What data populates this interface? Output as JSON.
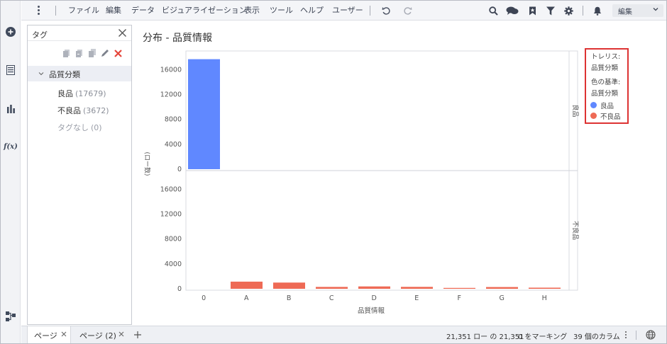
{
  "menubar": {
    "items": [
      "ファイル",
      "編集",
      "データ",
      "ビジュアライゼーション",
      "表示",
      "ツール",
      "ヘルプ",
      "ユーザー"
    ],
    "mode_label": "編集",
    "icons": [
      "search-icon",
      "comment-icon",
      "bookmark-icon",
      "filter-icon",
      "gear-icon",
      "bell-icon"
    ]
  },
  "rail": {
    "icons": [
      "add-icon",
      "data-table-icon",
      "visualization-icon",
      "fx-icon",
      "data-canvas-icon"
    ],
    "fx_label": "f(x)"
  },
  "tags": {
    "title": "タグ",
    "collection": "品質分類",
    "items": [
      {
        "label": "良品",
        "count": "(17679)"
      },
      {
        "label": "不良品",
        "count": "(3672)"
      },
      {
        "label": "タグなし",
        "count": "(0)"
      }
    ]
  },
  "visualization": {
    "title": "分布 - 品質情報"
  },
  "legend": {
    "trellis_label": "トレリス:",
    "trellis_value": "品質分類",
    "color_label": "色の基準:",
    "color_value": "品質分類",
    "entries": [
      {
        "name": "良品",
        "color": "#6088ff"
      },
      {
        "name": "不良品",
        "color": "#ee6a55"
      }
    ]
  },
  "chart_data": {
    "type": "bar",
    "title": "分布 - 品質情報",
    "xlabel": "品質情報",
    "ylabel": "(ロー数)",
    "categories": [
      "0",
      "A",
      "B",
      "C",
      "D",
      "E",
      "F",
      "G",
      "H"
    ],
    "yticks": [
      "0",
      "4000",
      "8000",
      "12000",
      "16000"
    ],
    "ylim": [
      0,
      19000
    ],
    "panels": [
      {
        "name": "良品",
        "color": "#6088ff",
        "values": [
          17679,
          0,
          0,
          0,
          0,
          0,
          0,
          0,
          0
        ]
      },
      {
        "name": "不良品",
        "color": "#ee6a55",
        "values": [
          0,
          1150,
          1000,
          300,
          380,
          310,
          140,
          280,
          180
        ]
      }
    ]
  },
  "footer": {
    "tabs": [
      "ページ",
      "ページ (2)"
    ],
    "row_count": "21,351 ロー の 21,351",
    "marked": "0 をマーキング",
    "columns": "39 個のカラム"
  }
}
